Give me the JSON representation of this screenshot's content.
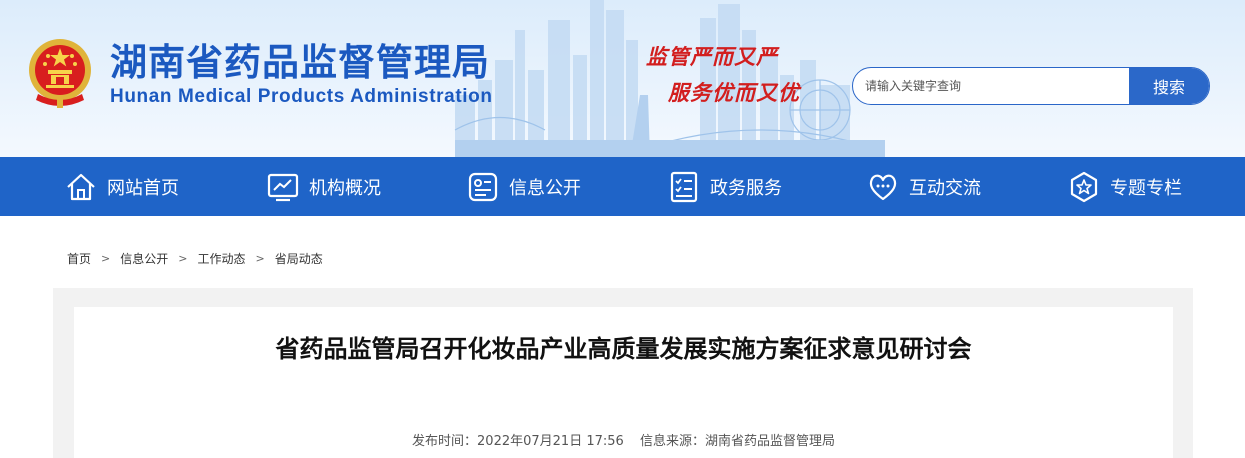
{
  "header": {
    "title_cn": "湖南省药品监督管理局",
    "title_en": "Hunan Medical Products Administration",
    "slogan_line1": "监管严而又严",
    "slogan_line2": "服务优而又优",
    "emblem_icon": "national-emblem-icon"
  },
  "search": {
    "placeholder": "请输入关键字查询",
    "button_label": "搜索"
  },
  "nav": {
    "items": [
      {
        "label": "网站首页",
        "icon": "home-icon"
      },
      {
        "label": "机构概况",
        "icon": "monitor-chart-icon"
      },
      {
        "label": "信息公开",
        "icon": "info-card-icon"
      },
      {
        "label": "政务服务",
        "icon": "checklist-icon"
      },
      {
        "label": "互动交流",
        "icon": "heart-chat-icon"
      },
      {
        "label": "专题专栏",
        "icon": "star-badge-icon"
      }
    ]
  },
  "breadcrumb": {
    "items": [
      "首页",
      "信息公开",
      "工作动态",
      "省局动态"
    ],
    "separator": ">"
  },
  "article": {
    "title": "省药品监管局召开化妆品产业高质量发展实施方案征求意见研讨会",
    "publish_time": "发布时间：2022年07月21日 17:56",
    "source": "信息来源：湖南省药品监督管理局"
  },
  "colors": {
    "brand_blue": "#1f64c8",
    "title_blue": "#1b59c0",
    "slogan_red": "#d21e1e",
    "content_bg": "#f2f2f2"
  }
}
